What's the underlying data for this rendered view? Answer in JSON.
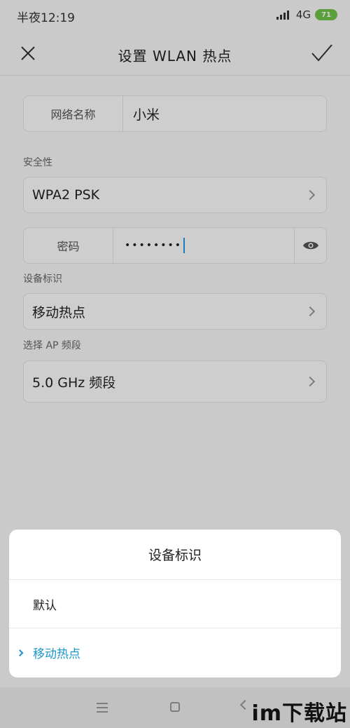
{
  "status_bar": {
    "time": "半夜12:19",
    "network": "4G",
    "battery": "71"
  },
  "title_bar": {
    "title": "设置 WLAN 热点"
  },
  "form": {
    "network_name_label": "网络名称",
    "network_name_value": "小米",
    "security_section": "安全性",
    "security_value": "WPA2 PSK",
    "password_label": "密码",
    "password_value": "••••••••",
    "device_id_section": "设备标识",
    "device_id_value": "移动热点",
    "ap_band_section": "选择 AP 频段",
    "ap_band_value": "5.0 GHz 频段"
  },
  "dialog": {
    "title": "设备标识",
    "options": [
      {
        "label": "默认",
        "selected": false
      },
      {
        "label": "移动热点",
        "selected": true
      }
    ]
  },
  "watermark": "im下载站",
  "colors": {
    "accent": "#1a97c9",
    "cursor": "#1e9be0",
    "battery": "#6fc24b"
  }
}
